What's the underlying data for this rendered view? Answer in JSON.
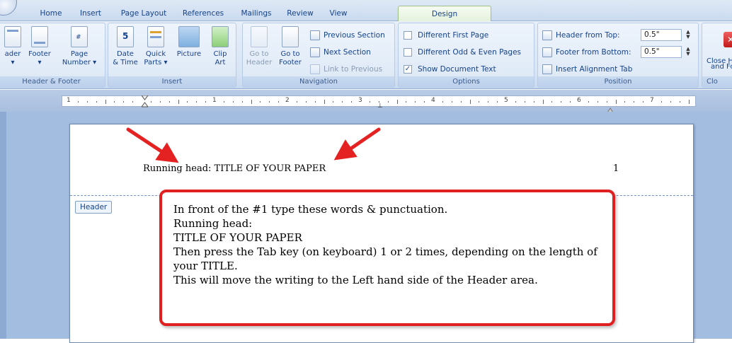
{
  "tabs": [
    {
      "label": "Home",
      "active": false
    },
    {
      "label": "Insert",
      "active": false
    },
    {
      "label": "Page Layout",
      "active": false
    },
    {
      "label": "References",
      "active": false
    },
    {
      "label": "Mailings",
      "active": false
    },
    {
      "label": "Review",
      "active": false
    },
    {
      "label": "View",
      "active": false
    },
    {
      "label": "Design",
      "active": true
    }
  ],
  "ribbon": {
    "header_footer": {
      "label": "Header & Footer",
      "header_btn": "ader",
      "footer_btn": "Footer",
      "page_number_line1": "Page",
      "page_number_line2": "Number ▾"
    },
    "insert": {
      "label": "Insert",
      "date_time_line1": "Date",
      "date_time_line2": "& Time",
      "quick_parts_line1": "Quick",
      "quick_parts_line2": "Parts ▾",
      "picture": "Picture",
      "clip_art_line1": "Clip",
      "clip_art_line2": "Art"
    },
    "navigation": {
      "label": "Navigation",
      "go_to_header_line1": "Go to",
      "go_to_header_line2": "Header",
      "go_to_footer_line1": "Go to",
      "go_to_footer_line2": "Footer",
      "previous_section": "Previous Section",
      "next_section": "Next Section",
      "link_to_previous": "Link to Previous"
    },
    "options": {
      "label": "Options",
      "different_first_page": "Different First Page",
      "different_odd_even": "Different Odd & Even Pages",
      "show_document_text": "Show Document Text",
      "show_document_text_checked": true
    },
    "position": {
      "label": "Position",
      "header_from_top": "Header from Top:",
      "header_from_top_value": "0.5\"",
      "footer_from_bottom": "Footer from Bottom:",
      "footer_from_bottom_value": "0.5\"",
      "insert_alignment_tab": "Insert Alignment Tab"
    },
    "close": {
      "label": "Clo",
      "close_line1": "Close H",
      "close_line2": "and Fo"
    }
  },
  "ruler": {
    "numbers": [
      "1",
      "1",
      "2",
      "3",
      "4",
      "5",
      "6",
      "7"
    ]
  },
  "document": {
    "running_head": "Running head: TITLE OF YOUR PAPER",
    "page_number": "1",
    "header_tag": "Header"
  },
  "callout": {
    "lines": [
      "In front of the #1 type these words & punctuation.",
      "Running head:",
      "TITLE OF YOUR PAPER",
      "Then press the Tab key (on keyboard) 1 or 2 times, depending on the length of",
      "your TITLE.",
      "This will move the writing to the Left hand side of the Header area."
    ]
  },
  "colors": {
    "accent_blue": "#15428b",
    "callout_red": "#e02020",
    "workspace_blue": "#a3bde0"
  }
}
